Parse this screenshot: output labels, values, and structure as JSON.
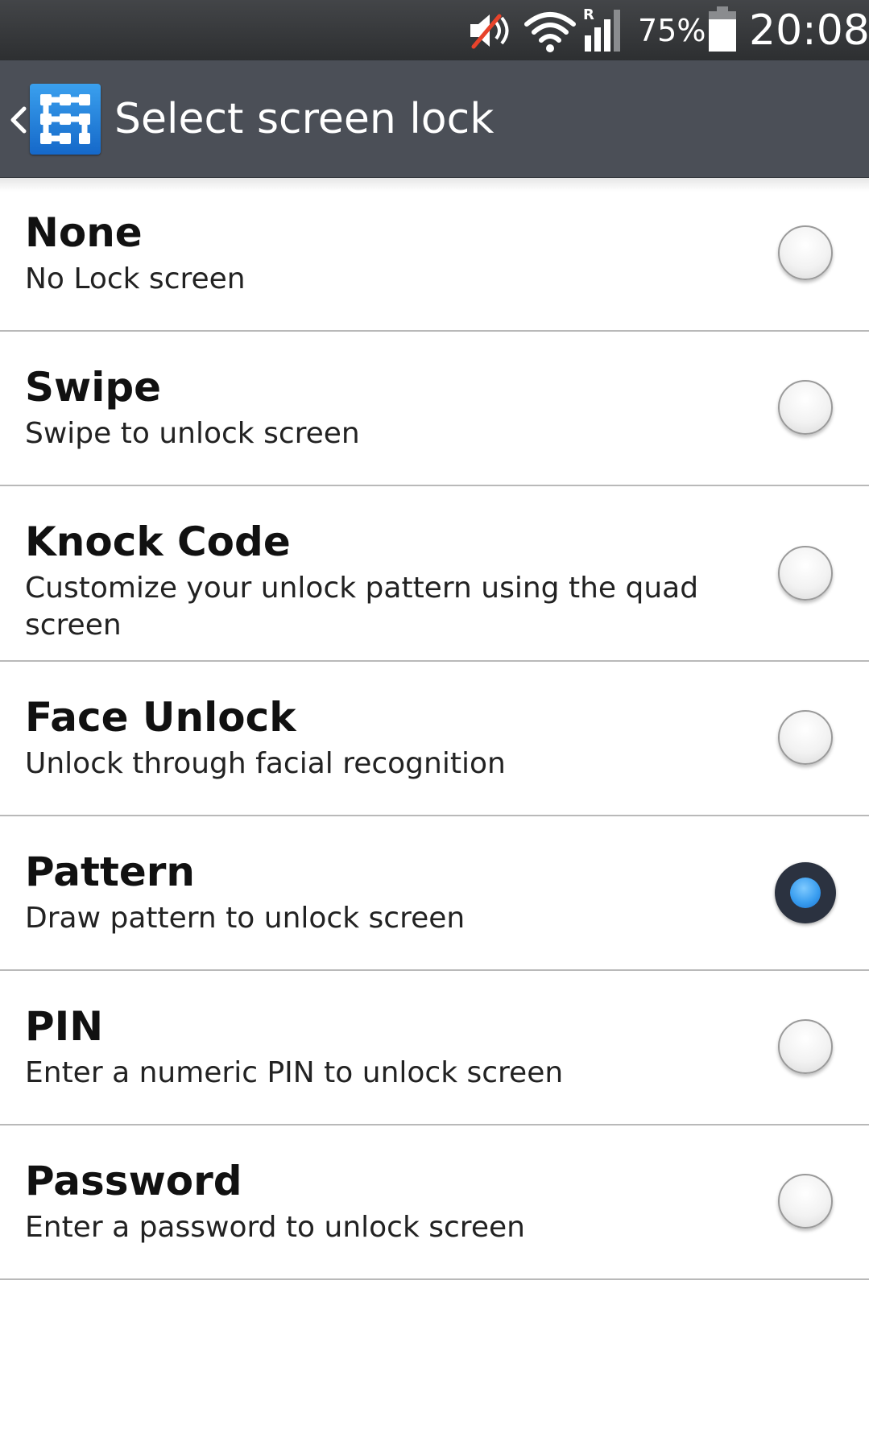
{
  "status_bar": {
    "battery_percent": "75%",
    "time": "20:08",
    "icons": [
      "volume-muted-icon",
      "wifi-icon",
      "signal-roaming-icon",
      "battery-icon"
    ]
  },
  "action_bar": {
    "title": "Select screen lock",
    "app_icon": "pattern-lock-icon",
    "back_icon": "chevron-left-icon",
    "background_color": "#4b4f57"
  },
  "options": [
    {
      "title": "None",
      "subtitle": "No Lock screen",
      "selected": false
    },
    {
      "title": "Swipe",
      "subtitle": "Swipe to unlock screen",
      "selected": false
    },
    {
      "title": "Knock Code",
      "subtitle": "Customize your unlock pattern using the quad screen",
      "selected": false
    },
    {
      "title": "Face Unlock",
      "subtitle": "Unlock through facial recognition",
      "selected": false
    },
    {
      "title": "Pattern",
      "subtitle": "Draw pattern to unlock screen",
      "selected": true
    },
    {
      "title": "PIN",
      "subtitle": "Enter a numeric PIN to unlock screen",
      "selected": false
    },
    {
      "title": "Password",
      "subtitle": "Enter a password to unlock screen",
      "selected": false
    }
  ],
  "colors": {
    "radio_selected_fill": "#3a9ef0",
    "radio_selected_ring": "#2b3240"
  }
}
